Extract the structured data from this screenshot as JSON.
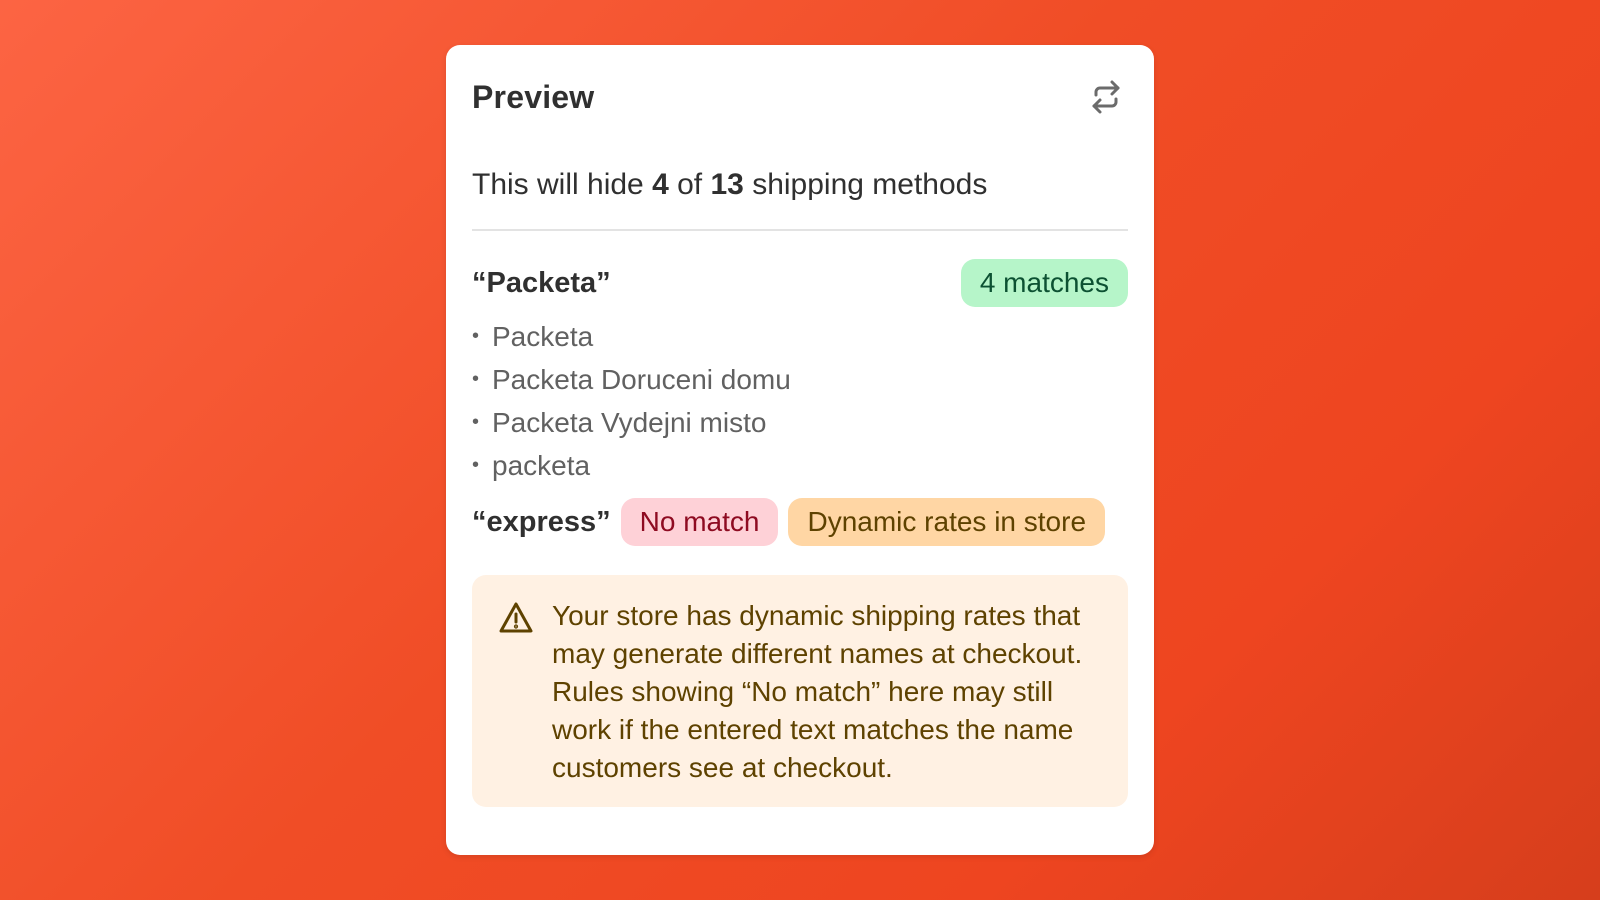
{
  "card": {
    "title": "Preview",
    "refresh_icon": "refresh-icon",
    "summary": {
      "prefix": "This will hide",
      "hidden_count": "4",
      "of": "of",
      "total_count": "13",
      "suffix": "shipping methods"
    }
  },
  "rules": [
    {
      "name": "“Packeta”",
      "badge": "4 matches",
      "matches": [
        "Packeta",
        "Packeta Doruceni domu",
        "Packeta Vydejni misto",
        "packeta"
      ]
    },
    {
      "name": "“express”",
      "badge": "No match",
      "extra_badge": "Dynamic rates in store"
    }
  ],
  "banner": {
    "icon": "warning-icon",
    "text": "Your store has dynamic shipping rates that may generate different names at checkout. Rules showing “No match” here may still work if the entered text matches the name customers see at checkout."
  },
  "colors": {
    "background": "#f04d26",
    "success_badge": "#b6f5c9",
    "critical_badge": "#fed1d7",
    "warning_badge": "#ffd6a4",
    "warning_banner": "#fff1e3"
  }
}
